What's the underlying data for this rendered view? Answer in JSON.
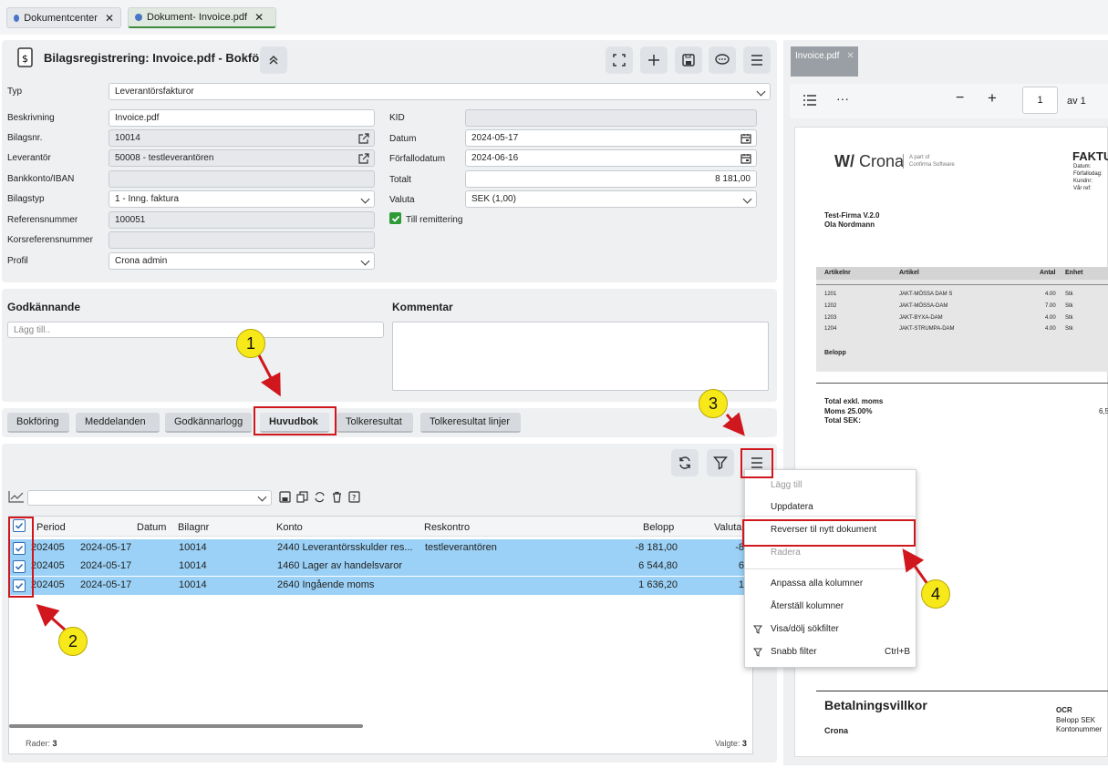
{
  "tabs": [
    {
      "label": "Dokumentcenter"
    },
    {
      "label": "Dokument- Invoice.pdf"
    }
  ],
  "header": {
    "title": "Bilagsregistrering: Invoice.pdf - Bokförd"
  },
  "form": {
    "typ": {
      "label": "Typ",
      "value": "Leverantörsfakturor"
    },
    "beskrivning": {
      "label": "Beskrivning",
      "value": "Invoice.pdf"
    },
    "bilagsnr": {
      "label": "Bilagsnr.",
      "value": "10014"
    },
    "leverantor": {
      "label": "Leverantör",
      "value": "50008 - testleverantören"
    },
    "bankkonto": {
      "label": "Bankkonto/IBAN",
      "value": ""
    },
    "bilagstyp": {
      "label": "Bilagstyp",
      "value": "1 - Inng. faktura"
    },
    "referensnummer": {
      "label": "Referensnummer",
      "value": "100051"
    },
    "korsreferens": {
      "label": "Korsreferensnummer",
      "value": ""
    },
    "profil": {
      "label": "Profil",
      "value": "Crona admin"
    },
    "kid": {
      "label": "KID",
      "value": ""
    },
    "datum": {
      "label": "Datum",
      "value": "2024-05-17"
    },
    "forfallodatum": {
      "label": "Förfallodatum",
      "value": "2024-06-16"
    },
    "totalt": {
      "label": "Totalt",
      "value": "8 181,00"
    },
    "valuta": {
      "label": "Valuta",
      "value": "SEK (1,00)"
    },
    "till_remittering": {
      "label": "Till remittering",
      "checked": true
    }
  },
  "approval": {
    "title": "Godkännande",
    "placeholder": "Lägg till..",
    "comment_title": "Kommentar"
  },
  "subtabs": [
    "Bokföring",
    "Meddelanden",
    "Godkännarlogg",
    "Huvudbok",
    "Tolkeresultat",
    "Tolkeresultat linjer"
  ],
  "grid": {
    "columns": [
      "Period",
      "Datum",
      "Bilagnr",
      "Konto",
      "Reskontro",
      "Belopp",
      "Valuta"
    ],
    "rows": [
      {
        "period": "202405",
        "datum": "2024-05-17",
        "bilagnr": "10014",
        "konto": "2440 Leverantörsskulder res...",
        "reskontro": "testleverantören",
        "belopp": "-8 181,00",
        "valuta": "-8"
      },
      {
        "period": "202405",
        "datum": "2024-05-17",
        "bilagnr": "10014",
        "konto": "1460 Lager av handelsvaror",
        "reskontro": "",
        "belopp": "6 544,80",
        "valuta": "6"
      },
      {
        "period": "202405",
        "datum": "2024-05-17",
        "bilagnr": "10014",
        "konto": "2640 Ingående moms",
        "reskontro": "",
        "belopp": "1 636,20",
        "valuta": "1"
      }
    ],
    "footer": {
      "rader_label": "Rader:",
      "rader": "3",
      "valgte_label": "Valgte:",
      "valgte": "3"
    }
  },
  "menu": {
    "items": [
      {
        "label": "Lägg till",
        "disabled": true
      },
      {
        "label": "Uppdatera"
      },
      {
        "label": "Reverser til nytt dokument"
      },
      {
        "label": "Radera",
        "disabled": true
      },
      {
        "label": "Anpassa alla kolumner"
      },
      {
        "label": "Återställ kolumner"
      },
      {
        "label": "Visa/dölj sökfilter"
      },
      {
        "label": "Snabb filter",
        "shortcut": "Ctrl+B"
      }
    ]
  },
  "badges": [
    "1",
    "2",
    "3",
    "4"
  ],
  "viewer": {
    "tab": "Invoice.pdf",
    "page": "1",
    "page_of": "av 1",
    "doc": {
      "logo": "Crona",
      "logo_sub1": "A part of",
      "logo_sub2": "Confirma Software",
      "heading": "FAKTU",
      "meta": [
        "Datum:",
        "Förfallodag:",
        "Kundnr:",
        "Vår ref:"
      ],
      "company": "Test-Firma V.2.0",
      "person": "Ola  Nordmann",
      "cols": [
        "Artikelnr",
        "Artikel",
        "Antal",
        "Enhet"
      ],
      "lines": [
        {
          "nr": "1201",
          "art": "JAKT-MÖSSA DAM S",
          "antal": "4.00",
          "enh": "Stk"
        },
        {
          "nr": "1202",
          "art": "JAKT-MÖSSA-DAM",
          "antal": "7.00",
          "enh": "Stk"
        },
        {
          "nr": "1203",
          "art": "JAKT-BYXA-DAM",
          "antal": "4.00",
          "enh": "Stk"
        },
        {
          "nr": "1204",
          "art": "JAKT-STRUMPA-DAM",
          "antal": "4.00",
          "enh": "Stk"
        }
      ],
      "belopp": "Belopp",
      "total_exkl": "Total exkl. moms",
      "moms": "Moms 25.00%",
      "moms_val": "6,5",
      "total_sek": "Total SEK:",
      "betal_title": "Betalningsvillkor",
      "crona": "Crona",
      "ocr": "OCR",
      "belopp_sek": "Belopp SEK",
      "kontonummer": "Kontonummer"
    }
  }
}
